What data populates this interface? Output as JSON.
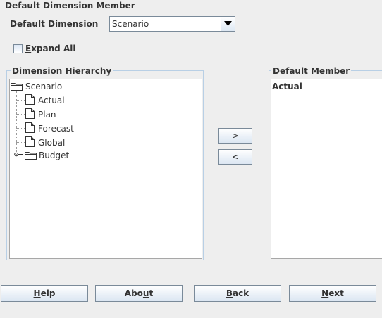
{
  "group": {
    "title": "Default Dimension Member"
  },
  "dimension": {
    "label": "Default Dimension",
    "selected": "Scenario"
  },
  "expand_all": {
    "label_mnemonic": "E",
    "label_rest": "xpand All",
    "checked": false
  },
  "hierarchy": {
    "title": "Dimension Hierarchy",
    "root": "Scenario",
    "children": [
      "Actual",
      "Plan",
      "Forecast",
      "Global",
      "Budget"
    ]
  },
  "default_member": {
    "title": "Default Member",
    "value": "Actual"
  },
  "arrows": {
    "add": ">",
    "remove": "<"
  },
  "buttons": {
    "help_m": "H",
    "help_r": "elp",
    "about_a": "Abo",
    "about_m": "u",
    "about_b": "t",
    "back_m": "B",
    "back_r": "ack",
    "next_m": "N",
    "next_r": "ext"
  },
  "icons": {
    "folder": "folder-icon",
    "document": "document-icon",
    "dropdown": "chevron-down-icon",
    "expand": "tree-expand-handle-icon"
  }
}
